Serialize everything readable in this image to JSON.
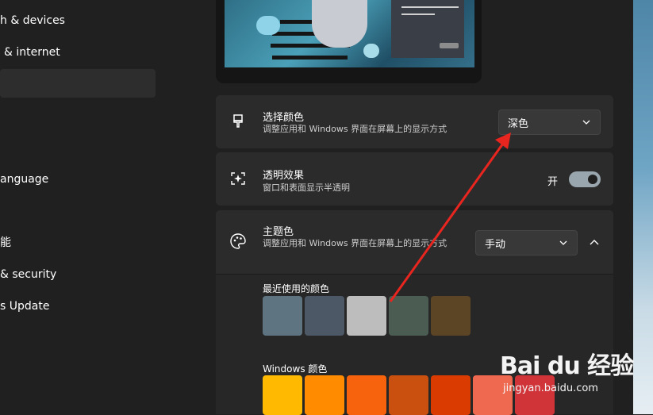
{
  "sidebar": {
    "items": [
      {
        "label": "h & devices"
      },
      {
        "label": "& internet"
      },
      {
        "label": ""
      },
      {
        "label": "anguage"
      },
      {
        "label": "能"
      },
      {
        "label": "& security"
      },
      {
        "label": "s Update"
      }
    ]
  },
  "color_mode": {
    "title": "选择颜色",
    "description": "调整应用和 Windows 界面在屏幕上的显示方式",
    "value": "深色"
  },
  "transparency": {
    "title": "透明效果",
    "description": "窗口和表面显示半透明",
    "state_label": "开",
    "enabled": true
  },
  "accent": {
    "title": "主题色",
    "description": "调整应用和 Windows 界面在屏幕上的显示方式",
    "value": "手动",
    "expanded": true,
    "recent_label": "最近使用的颜色",
    "recent_colors": [
      "#5f7481",
      "#4c5866",
      "#bdbdbd",
      "#4b5c53",
      "#5c4525"
    ],
    "windows_label": "Windows 颜色",
    "windows_colors": [
      "#ffb900",
      "#ff8c00",
      "#f7630c",
      "#ca5010",
      "#da3b01",
      "#ef6950",
      "#d13438"
    ]
  },
  "icons": {
    "color_mode": "paint-brush-icon",
    "transparency": "sparkle-frame-icon",
    "accent": "palette-icon"
  },
  "watermark": {
    "brand": "Bai du 经验",
    "url": "jingyan.baidu.com"
  },
  "annotation_color": "#e8251f"
}
